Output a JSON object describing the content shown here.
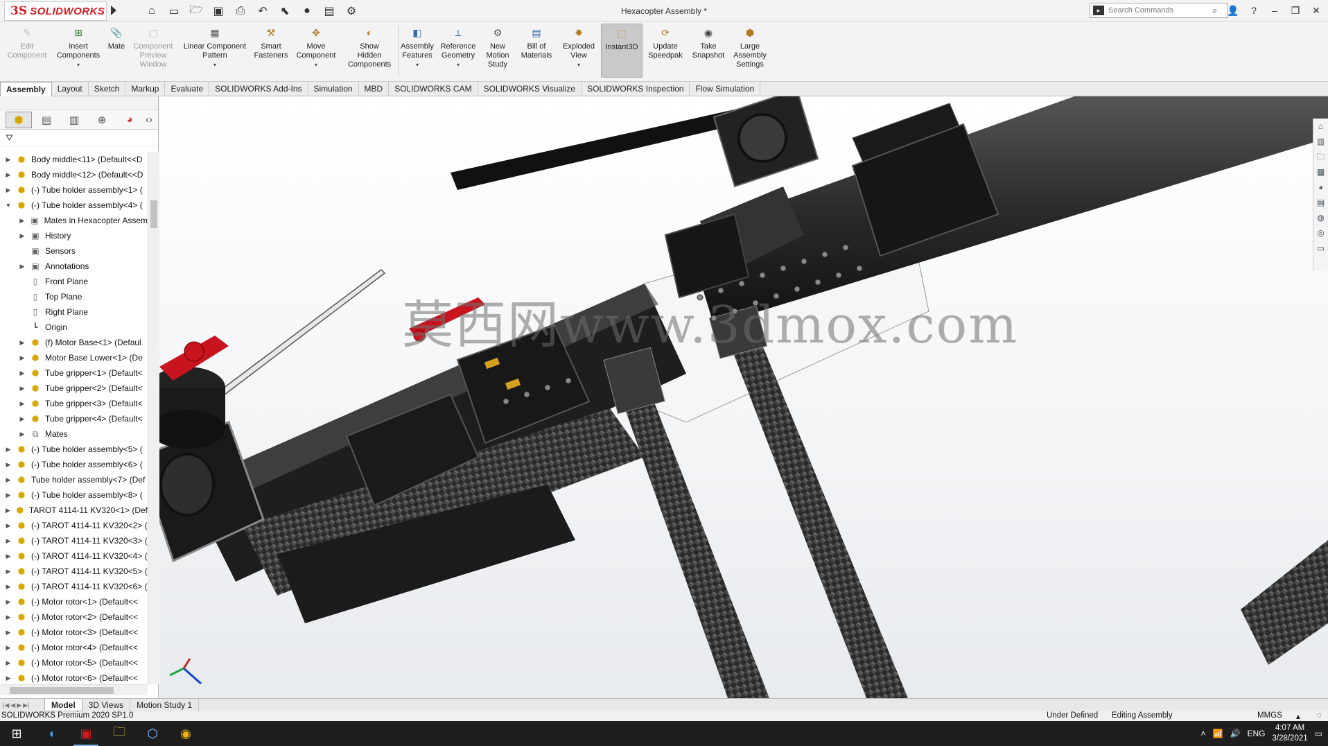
{
  "app": {
    "name": "SOLIDWORKS",
    "ds_mark": "3S",
    "document_title": "Hexacopter Assembly *"
  },
  "search": {
    "placeholder": "Search Commands"
  },
  "commands": [
    {
      "label1": "Edit",
      "label2": "Component",
      "label3": "",
      "label4": "",
      "enabled": false
    },
    {
      "label1": "Insert",
      "label2": "Components",
      "label3": "",
      "label4": "",
      "enabled": true
    },
    {
      "label1": "Mate",
      "label2": "",
      "label3": "",
      "label4": "",
      "enabled": true
    },
    {
      "label1": "Component",
      "label2": "Preview",
      "label3": "Window",
      "label4": "",
      "enabled": false
    },
    {
      "label1": "Linear Component",
      "label2": "Pattern",
      "label3": "",
      "label4": "",
      "enabled": true
    },
    {
      "label1": "Smart",
      "label2": "Fasteners",
      "label3": "",
      "label4": "",
      "enabled": true
    },
    {
      "label1": "Move",
      "label2": "Component",
      "label3": "",
      "label4": "",
      "enabled": true
    },
    {
      "label1": "Show",
      "label2": "Hidden",
      "label3": "Components",
      "label4": "",
      "enabled": true
    },
    {
      "label1": "Assembly",
      "label2": "Features",
      "label3": "",
      "label4": "",
      "enabled": true
    },
    {
      "label1": "Reference",
      "label2": "Geometry",
      "label3": "",
      "label4": "",
      "enabled": true
    },
    {
      "label1": "New",
      "label2": "Motion",
      "label3": "Study",
      "label4": "",
      "enabled": true
    },
    {
      "label1": "Bill of",
      "label2": "Materials",
      "label3": "",
      "label4": "",
      "enabled": true
    },
    {
      "label1": "Exploded",
      "label2": "View",
      "label3": "",
      "label4": "",
      "enabled": true
    },
    {
      "label1": "Instant3D",
      "label2": "",
      "label3": "",
      "label4": "",
      "enabled": true
    },
    {
      "label1": "Update",
      "label2": "Speedpak",
      "label3": "",
      "label4": "",
      "enabled": true
    },
    {
      "label1": "Take",
      "label2": "Snapshot",
      "label3": "",
      "label4": "",
      "enabled": true
    },
    {
      "label1": "Large",
      "label2": "Assembly",
      "label3": "Settings",
      "label4": "",
      "enabled": true
    }
  ],
  "tabs": [
    "Assembly",
    "Layout",
    "Sketch",
    "Markup",
    "Evaluate",
    "SOLIDWORKS Add-Ins",
    "Simulation",
    "MBD",
    "SOLIDWORKS CAM",
    "SOLIDWORKS Visualize",
    "SOLIDWORKS Inspection",
    "Flow Simulation"
  ],
  "tree": [
    {
      "label": "Body middle<11> (Default<<D",
      "indent": 0,
      "expander": "▶",
      "icon": "part"
    },
    {
      "label": "Body middle<12> (Default<<D",
      "indent": 0,
      "expander": "▶",
      "icon": "part"
    },
    {
      "label": "(-) Tube holder assembly<1> (",
      "indent": 0,
      "expander": "▶",
      "icon": "asm"
    },
    {
      "label": "(-) Tube holder assembly<4> (",
      "indent": 0,
      "expander": "▼",
      "icon": "asm"
    },
    {
      "label": "Mates in Hexacopter Assem",
      "indent": 1,
      "expander": "▶",
      "icon": "folder"
    },
    {
      "label": "History",
      "indent": 1,
      "expander": "▶",
      "icon": "folder"
    },
    {
      "label": "Sensors",
      "indent": 1,
      "expander": "",
      "icon": "folder"
    },
    {
      "label": "Annotations",
      "indent": 1,
      "expander": "▶",
      "icon": "folder"
    },
    {
      "label": "Front Plane",
      "indent": 1,
      "expander": "",
      "icon": "plane"
    },
    {
      "label": "Top Plane",
      "indent": 1,
      "expander": "",
      "icon": "plane"
    },
    {
      "label": "Right Plane",
      "indent": 1,
      "expander": "",
      "icon": "plane"
    },
    {
      "label": "Origin",
      "indent": 1,
      "expander": "",
      "icon": "origin"
    },
    {
      "label": "(f) Motor Base<1> (Defaul",
      "indent": 1,
      "expander": "▶",
      "icon": "part"
    },
    {
      "label": "Motor Base Lower<1> (De",
      "indent": 1,
      "expander": "▶",
      "icon": "part"
    },
    {
      "label": "Tube gripper<1> (Default<",
      "indent": 1,
      "expander": "▶",
      "icon": "part"
    },
    {
      "label": "Tube gripper<2> (Default<",
      "indent": 1,
      "expander": "▶",
      "icon": "part"
    },
    {
      "label": "Tube gripper<3> (Default<",
      "indent": 1,
      "expander": "▶",
      "icon": "part"
    },
    {
      "label": "Tube gripper<4> (Default<",
      "indent": 1,
      "expander": "▶",
      "icon": "part"
    },
    {
      "label": "Mates",
      "indent": 1,
      "expander": "▶",
      "icon": "mates"
    },
    {
      "label": "(-) Tube holder assembly<5> (",
      "indent": 0,
      "expander": "▶",
      "icon": "asm"
    },
    {
      "label": "(-) Tube holder assembly<6> (",
      "indent": 0,
      "expander": "▶",
      "icon": "asm"
    },
    {
      "label": "Tube holder assembly<7> (Def",
      "indent": 0,
      "expander": "▶",
      "icon": "asm"
    },
    {
      "label": "(-) Tube holder assembly<8> (",
      "indent": 0,
      "expander": "▶",
      "icon": "asm"
    },
    {
      "label": "TAROT 4114-11 KV320<1> (Def",
      "indent": 0,
      "expander": "▶",
      "icon": "asm"
    },
    {
      "label": "(-) TAROT 4114-11 KV320<2> (",
      "indent": 0,
      "expander": "▶",
      "icon": "asm"
    },
    {
      "label": "(-) TAROT 4114-11 KV320<3> (",
      "indent": 0,
      "expander": "▶",
      "icon": "asm"
    },
    {
      "label": "(-) TAROT 4114-11 KV320<4> (",
      "indent": 0,
      "expander": "▶",
      "icon": "asm"
    },
    {
      "label": "(-) TAROT 4114-11 KV320<5> (",
      "indent": 0,
      "expander": "▶",
      "icon": "asm"
    },
    {
      "label": "(-) TAROT 4114-11 KV320<6> (",
      "indent": 0,
      "expander": "▶",
      "icon": "asm"
    },
    {
      "label": "(-) Motor rotor<1> (Default<<",
      "indent": 0,
      "expander": "▶",
      "icon": "part"
    },
    {
      "label": "(-) Motor rotor<2> (Default<<",
      "indent": 0,
      "expander": "▶",
      "icon": "part"
    },
    {
      "label": "(-) Motor rotor<3> (Default<<",
      "indent": 0,
      "expander": "▶",
      "icon": "part"
    },
    {
      "label": "(-) Motor rotor<4> (Default<<",
      "indent": 0,
      "expander": "▶",
      "icon": "part"
    },
    {
      "label": "(-) Motor rotor<5> (Default<<",
      "indent": 0,
      "expander": "▶",
      "icon": "part"
    },
    {
      "label": "(-) Motor rotor<6> (Default<<",
      "indent": 0,
      "expander": "▶",
      "icon": "part"
    }
  ],
  "watermark": "莫西网www.3dmox.com",
  "bottom_tabs": [
    "Model",
    "3D Views",
    "Motion Study 1"
  ],
  "status": {
    "version": "SOLIDWORKS Premium 2020 SP1.0",
    "state": "Under Defined",
    "mode": "Editing Assembly",
    "units": "MMGS"
  },
  "taskbar": {
    "lang": "ENG",
    "time": "4:07 AM",
    "date": "3/28/2021"
  },
  "colors": {
    "brand_red": "#d71920",
    "carbon_dark": "#2a2a2a",
    "anodized_red": "#c8141e",
    "background_top": "#ffffff",
    "taskbar": "#1e1e1e"
  }
}
